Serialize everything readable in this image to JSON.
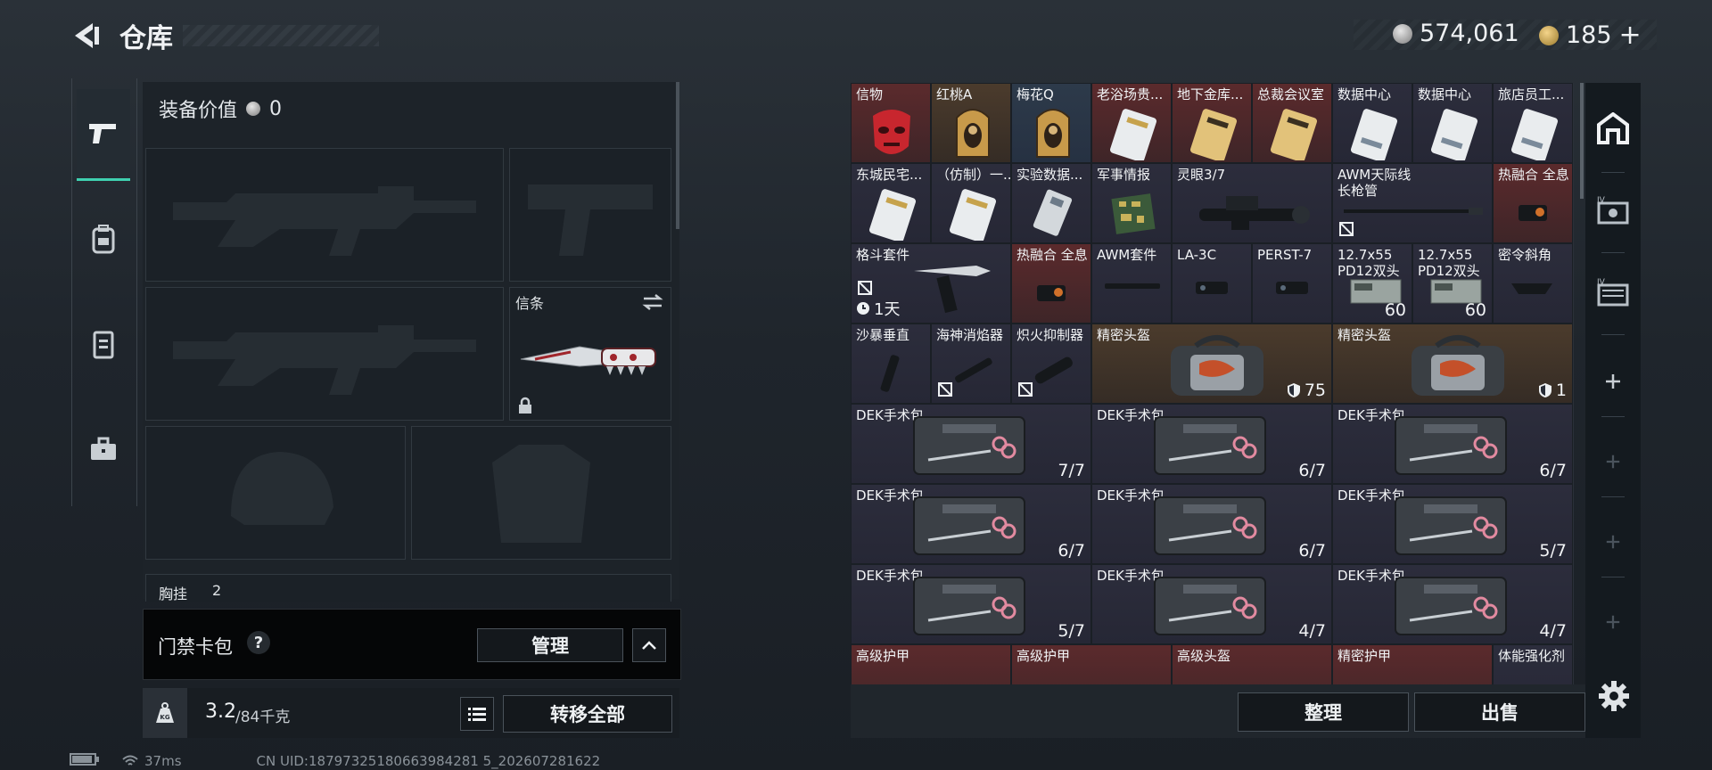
{
  "header": {
    "title": "仓库",
    "silver_amount": "574,061",
    "gold_amount": "185",
    "gold_plus": "+"
  },
  "equipment": {
    "value_label": "装备价值",
    "value": "0",
    "melee_slot_label": "信条",
    "chest_rig_label": "胸挂",
    "chest_rig_count": "2"
  },
  "keycase": {
    "label": "门禁卡包",
    "help": "?",
    "manage_button": "管理"
  },
  "bottom": {
    "weight_current": "3.2",
    "weight_max": "/84千克",
    "weight_icon_text": "KG",
    "transfer_all": "转移全部"
  },
  "status": {
    "ping": "37ms",
    "uid": "CN UID:18797325180663984281 5_202607281622"
  },
  "inventory": {
    "row1": [
      "信物",
      "红桃A",
      "梅花Q",
      "老浴场贵...",
      "地下金库...",
      "总裁会议室",
      "数据中心",
      "数据中心",
      "旅店员工..."
    ],
    "row2": [
      "东城民宅...",
      "（仿制）一...",
      "实验数据...",
      "军事情报",
      "灵眼3/7",
      "AWM天际线\n长枪管",
      "热融合 全息"
    ],
    "row3": [
      "格斗套件",
      "热融合 全息",
      "AWM套件",
      "LA-3C",
      "PERST-7",
      "12.7x55\nPD12双头",
      "12.7x55\nPD12双头",
      "密令斜角"
    ],
    "row3_extra": {
      "timer": "1天",
      "count_a": "60",
      "count_b": "60"
    },
    "row4": [
      "沙暴垂直",
      "海神消焰器",
      "炽火抑制器",
      "精密头盔",
      "精密头盔"
    ],
    "row4_extra": {
      "helmet_a": "75",
      "helmet_b": "1"
    },
    "medkit_label": "DEK手术包",
    "medkit_counts": [
      "7/7",
      "6/7",
      "6/7",
      "6/7",
      "6/7",
      "5/7",
      "5/7",
      "4/7",
      "4/7"
    ],
    "row8": [
      "高级护甲",
      "高级护甲",
      "高级头盔",
      "精密护甲",
      "体能强化剂"
    ]
  },
  "actions": {
    "organize": "整理",
    "sell": "出售"
  },
  "colors": {
    "accent": "#3fd0b0",
    "red_rarity": "#5b2a2c",
    "gold_rarity": "#4b3b2c",
    "blue_rarity": "#2d3a4a",
    "purple_rarity": "#2c2d3c"
  }
}
